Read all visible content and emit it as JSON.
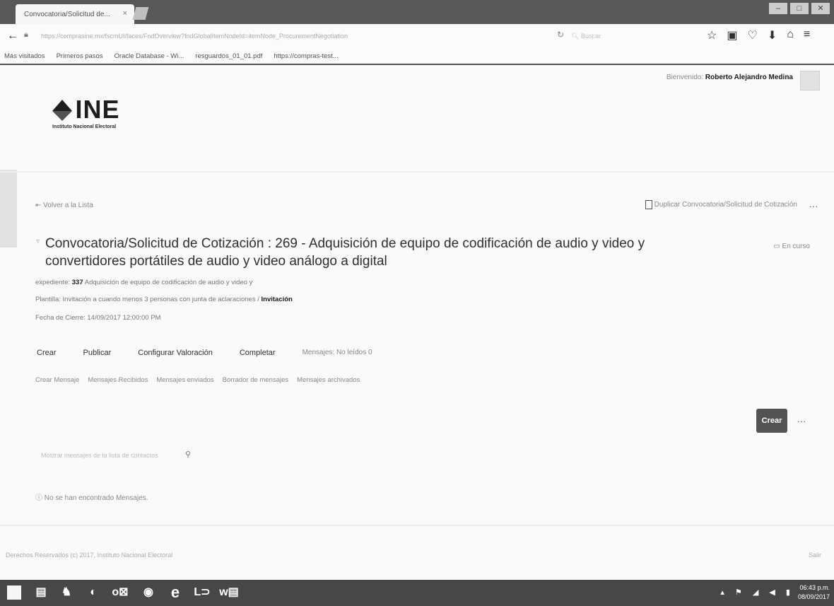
{
  "browser": {
    "tab_title": "Convocatoria/Solicitud de...",
    "tab_close": "×",
    "url": "https://comprasine.mx/fscmUI/faces/FndOverview?fndGlobalItemNodeId=itemNode_ProcurementNegotiation",
    "search_placeholder": "Buscar",
    "bookmarks": [
      "Más visitados",
      "Primeros pasos",
      "Oracle Database - Wi...",
      "resguardos_01_01.pdf",
      "https://compras-test..."
    ]
  },
  "header": {
    "greeting_prefix": "Bienvenido:",
    "user_name": "Roberto Alejandro Medina",
    "logo_text": "INE",
    "logo_subtitle": "Instituto Nacional Electoral"
  },
  "actions": {
    "back_label": "Volver a la Lista",
    "duplicate_label": "Duplicar Convocatoria/Solicitud de Cotización",
    "more_label": "..."
  },
  "negotiation": {
    "title": "Convocatoria/Solicitud de Cotización : 269 - Adquisición de equipo de codificación de audio y video y convertidores portátiles de audio y video análogo a digital",
    "status": "En curso",
    "expediente_label": "expediente:",
    "expediente_value": "337",
    "expediente_desc": "Adquisición de equipo de codificación de audio y video y",
    "style_label": "Plantilla: Invitación a cuando menos 3 personas con junta de aclaraciones /",
    "style_value": "Invitación",
    "close_date": "Fecha de Cierre: 14/09/2017 12:00:00 PM"
  },
  "tabs": {
    "items": [
      "Crear",
      "Publicar",
      "Configurar Valoración",
      "Completar"
    ],
    "messages": "Mensajes: No leídos 0"
  },
  "subtabs": [
    "Crear Mensaje",
    "Mensajes Recibidos",
    "Mensajes enviados",
    "Borrador de mensajes",
    "Mensajes archivados"
  ],
  "buttons": {
    "create": "Crear",
    "more": "..."
  },
  "filter": {
    "placeholder": "Mostrar mensajes de la lista de contactos"
  },
  "empty_message": "No se han encontrado Mensajes.",
  "footer": {
    "copyright": "Derechos Reservados (c) 2017, Instituto Nacional Electoral",
    "right": "Salir"
  },
  "taskbar": {
    "time": "06:43 p.m.",
    "date": "08/09/2017"
  }
}
